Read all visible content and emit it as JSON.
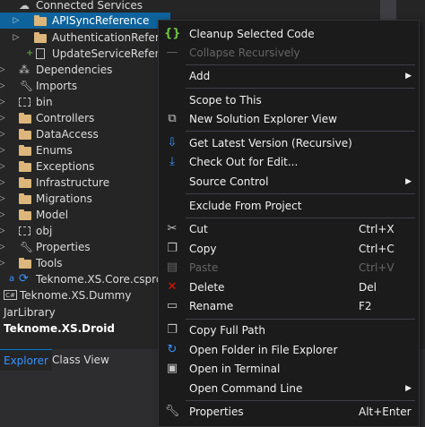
{
  "tree": {
    "items": [
      {
        "label": "Connected Services"
      },
      {
        "label": "APISyncReference"
      },
      {
        "label": "AuthenticationReferen"
      },
      {
        "label": "UpdateServiceReferenc"
      },
      {
        "label": "Dependencies"
      },
      {
        "label": "Imports"
      },
      {
        "label": "bin"
      },
      {
        "label": "Controllers"
      },
      {
        "label": "DataAccess"
      },
      {
        "label": "Enums"
      },
      {
        "label": "Exceptions"
      },
      {
        "label": "Infrastructure"
      },
      {
        "label": "Migrations"
      },
      {
        "label": "Model"
      },
      {
        "label": "obj"
      },
      {
        "label": "Properties"
      },
      {
        "label": "Tools"
      },
      {
        "label": "Teknome.XS.Core.csproj.vs"
      },
      {
        "label": "Teknome.XS.Dummy"
      },
      {
        "label": "JarLibrary"
      },
      {
        "label": "Teknome.XS.Droid"
      }
    ]
  },
  "bottom_tabs": {
    "explorer": "Explorer",
    "class_view": "Class View"
  },
  "menu": {
    "cleanup": "Cleanup Selected Code",
    "collapse": "Collapse Recursively",
    "add": "Add",
    "scope": "Scope to This",
    "new_view": "New Solution Explorer View",
    "get_latest": "Get Latest Version (Recursive)",
    "checkout": "Check Out for Edit...",
    "source_control": "Source Control",
    "exclude": "Exclude From Project",
    "cut": "Cut",
    "cut_sc": "Ctrl+X",
    "copy": "Copy",
    "copy_sc": "Ctrl+C",
    "paste": "Paste",
    "paste_sc": "Ctrl+V",
    "delete": "Delete",
    "delete_sc": "Del",
    "rename": "Rename",
    "rename_sc": "F2",
    "copy_path": "Copy Full Path",
    "open_folder": "Open Folder in File Explorer",
    "open_terminal": "Open in Terminal",
    "open_cmd": "Open Command Line",
    "properties": "Properties",
    "properties_sc": "Alt+Enter"
  },
  "colors": {
    "selection": "#0e639c",
    "folder": "#dcb67a",
    "menu_bg": "#1b1b1c",
    "accent": "#3794ff"
  }
}
